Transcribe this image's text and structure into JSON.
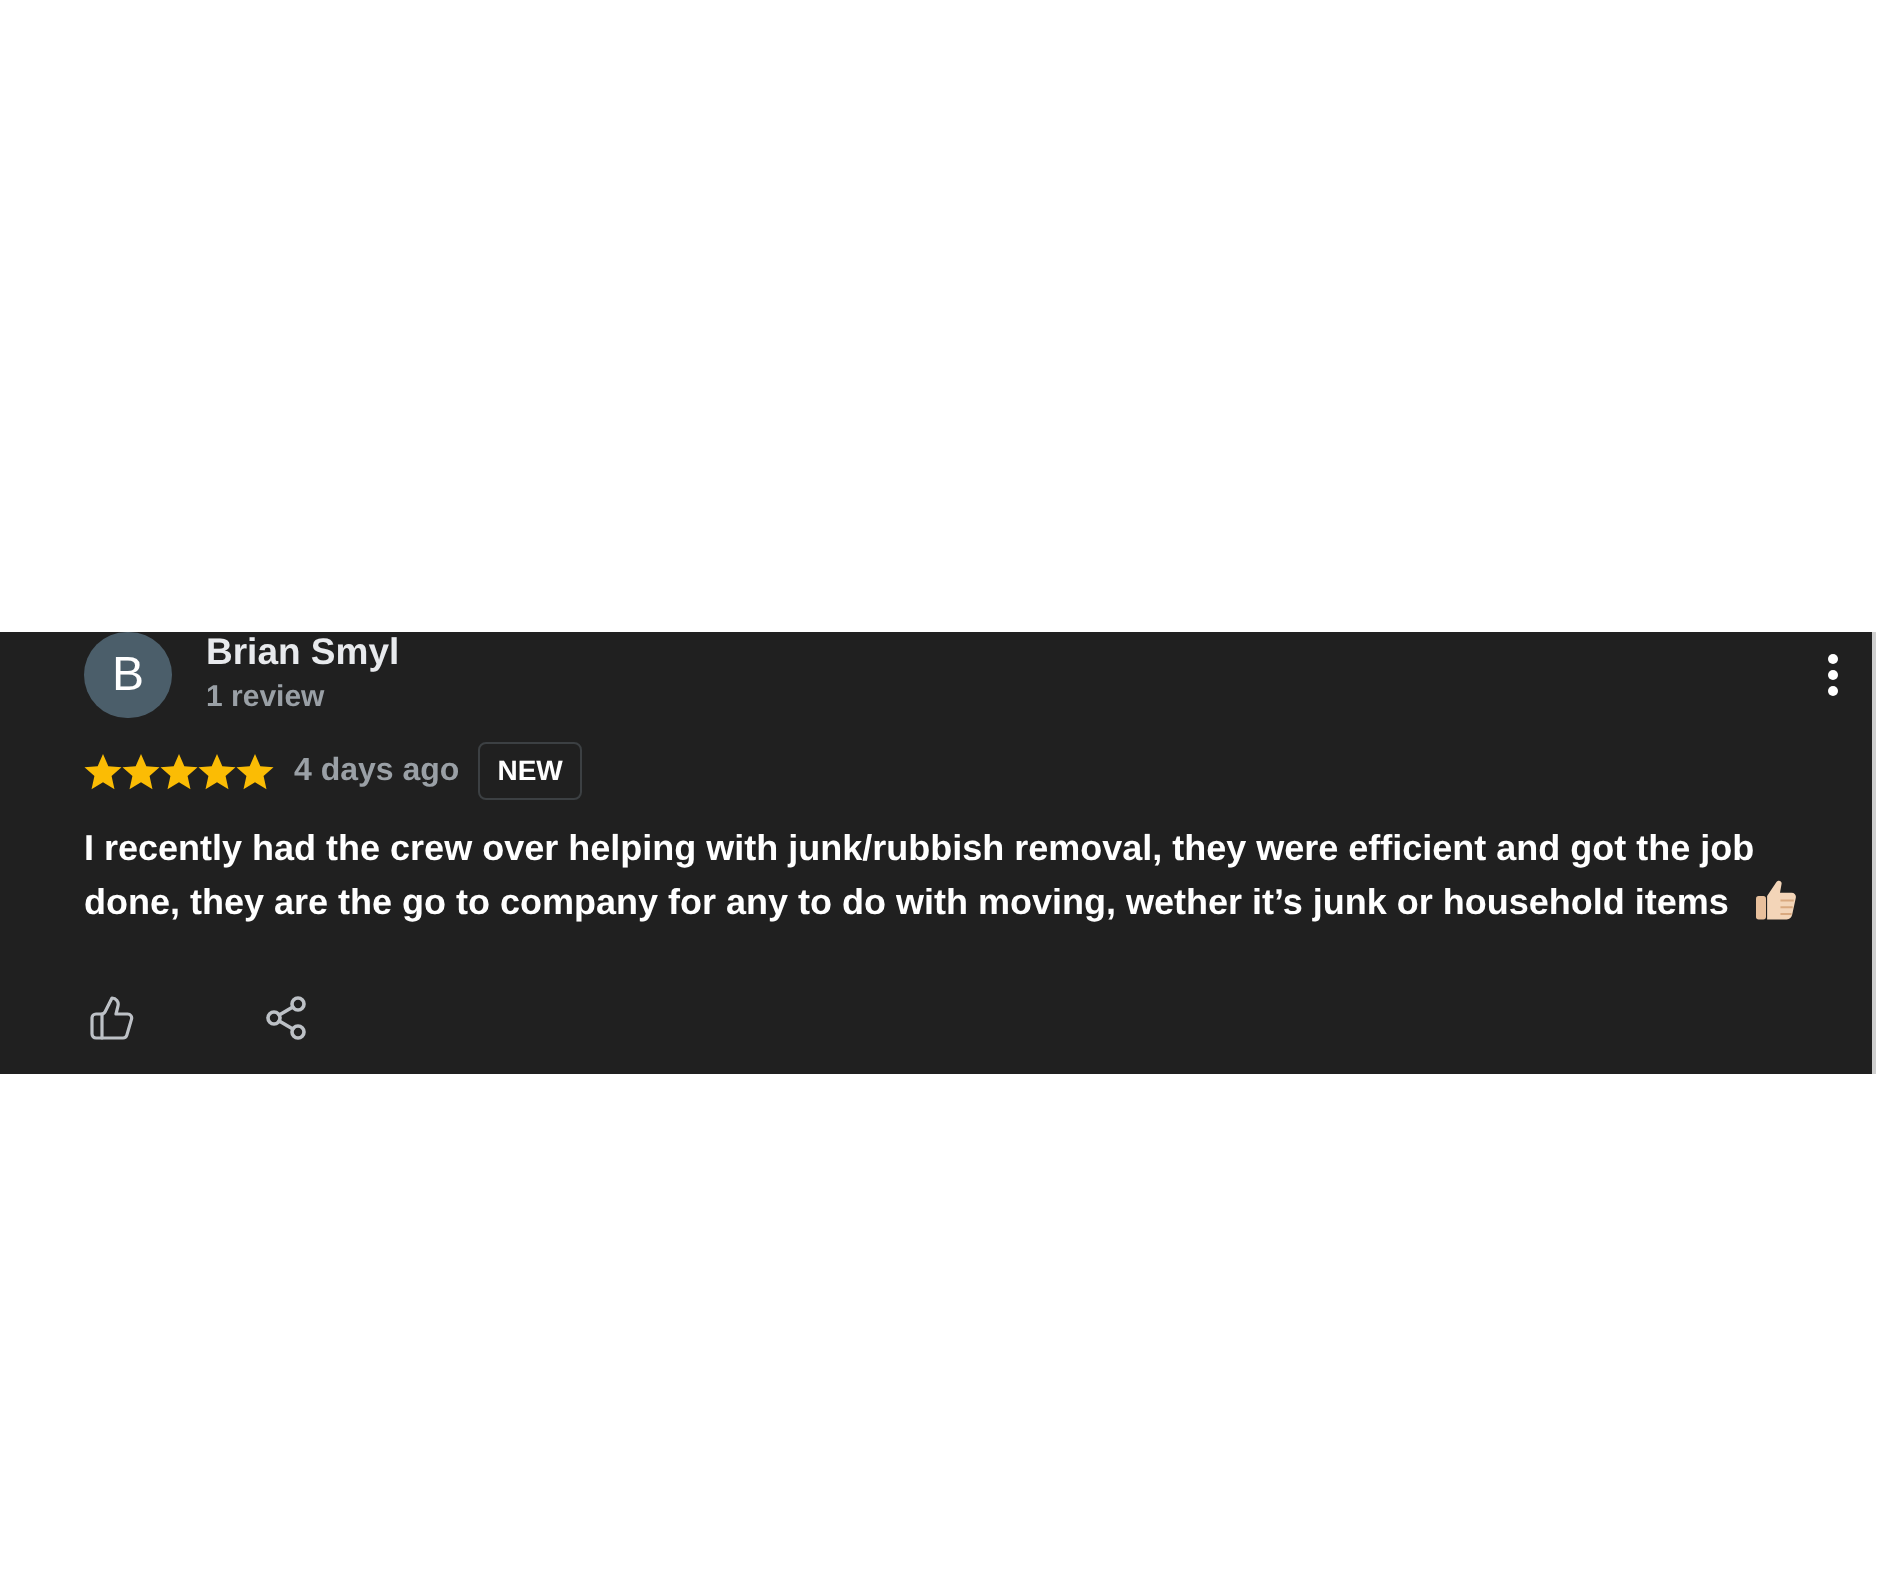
{
  "review": {
    "author": {
      "initial": "B",
      "name": "Brian Smyl",
      "review_count": "1 review"
    },
    "stars": 5,
    "time": "4 days ago",
    "badge": "NEW",
    "text": "I recently had the crew over helping with junk/rubbish removal, they were efficient and got the job done, they are the go to company for any to do with moving, wether it’s junk or household items"
  }
}
